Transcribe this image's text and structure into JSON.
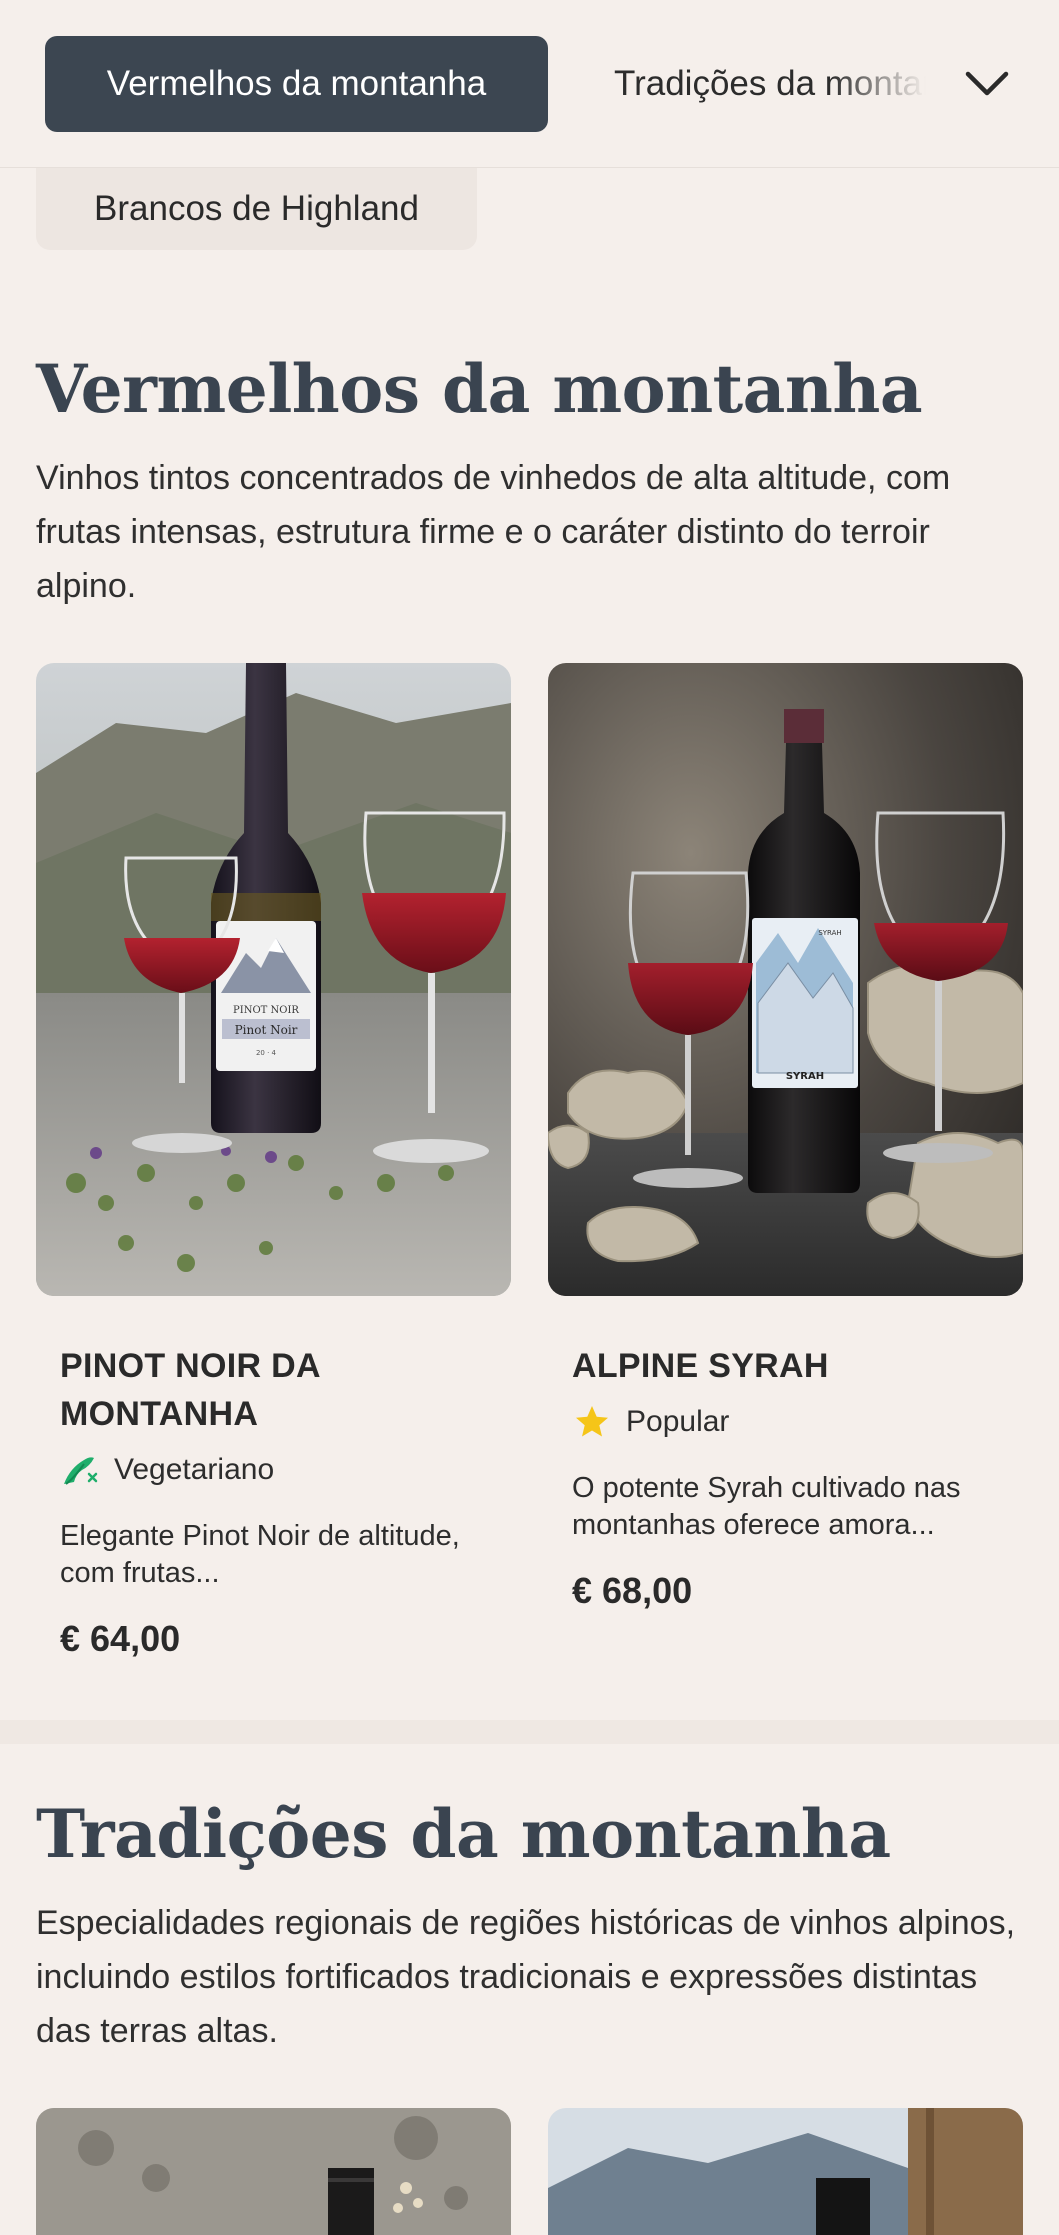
{
  "nav": {
    "active_tab": "Vermelhos da montanha",
    "next_tab": "Tradições da montanha",
    "secondary_tab": "Brancos de Highland"
  },
  "sections": [
    {
      "title": "Vermelhos da montanha",
      "description": "Vinhos tintos concentrados de vinhedos de alta altitude, com frutas intensas, estrutura firme e o caráter distinto do terroir alpino.",
      "products": [
        {
          "title": "PINOT NOIR DA MONTANHA",
          "badge": "Vegetariano",
          "badge_icon": "vegetarian-icon",
          "description": "Elegante Pinot Noir de altitude, com frutas...",
          "price": "€ 64,00",
          "label_line1": "PINOT NOIR",
          "label_line2": "Pinot Noir",
          "label_line3": "20 · 4"
        },
        {
          "title": "ALPINE SYRAH",
          "badge": "Popular",
          "badge_icon": "star-icon",
          "description": "O potente Syrah cultivado nas montanhas oferece amora...",
          "price": "€ 68,00",
          "label_line1": "SYRAH",
          "label_line2": "SYRAH"
        }
      ]
    },
    {
      "title": "Tradições da montanha",
      "description": "Especialidades regionais de regiões históricas de vinhos alpinos, incluindo estilos fortificados tradicionais e expressões distintas das terras altas."
    }
  ],
  "colors": {
    "background": "#f5efeb",
    "active_tab": "#3c4651",
    "heading": "#3a4450",
    "vegetarian_green": "#1fae6b",
    "star_yellow": "#f5c518"
  }
}
